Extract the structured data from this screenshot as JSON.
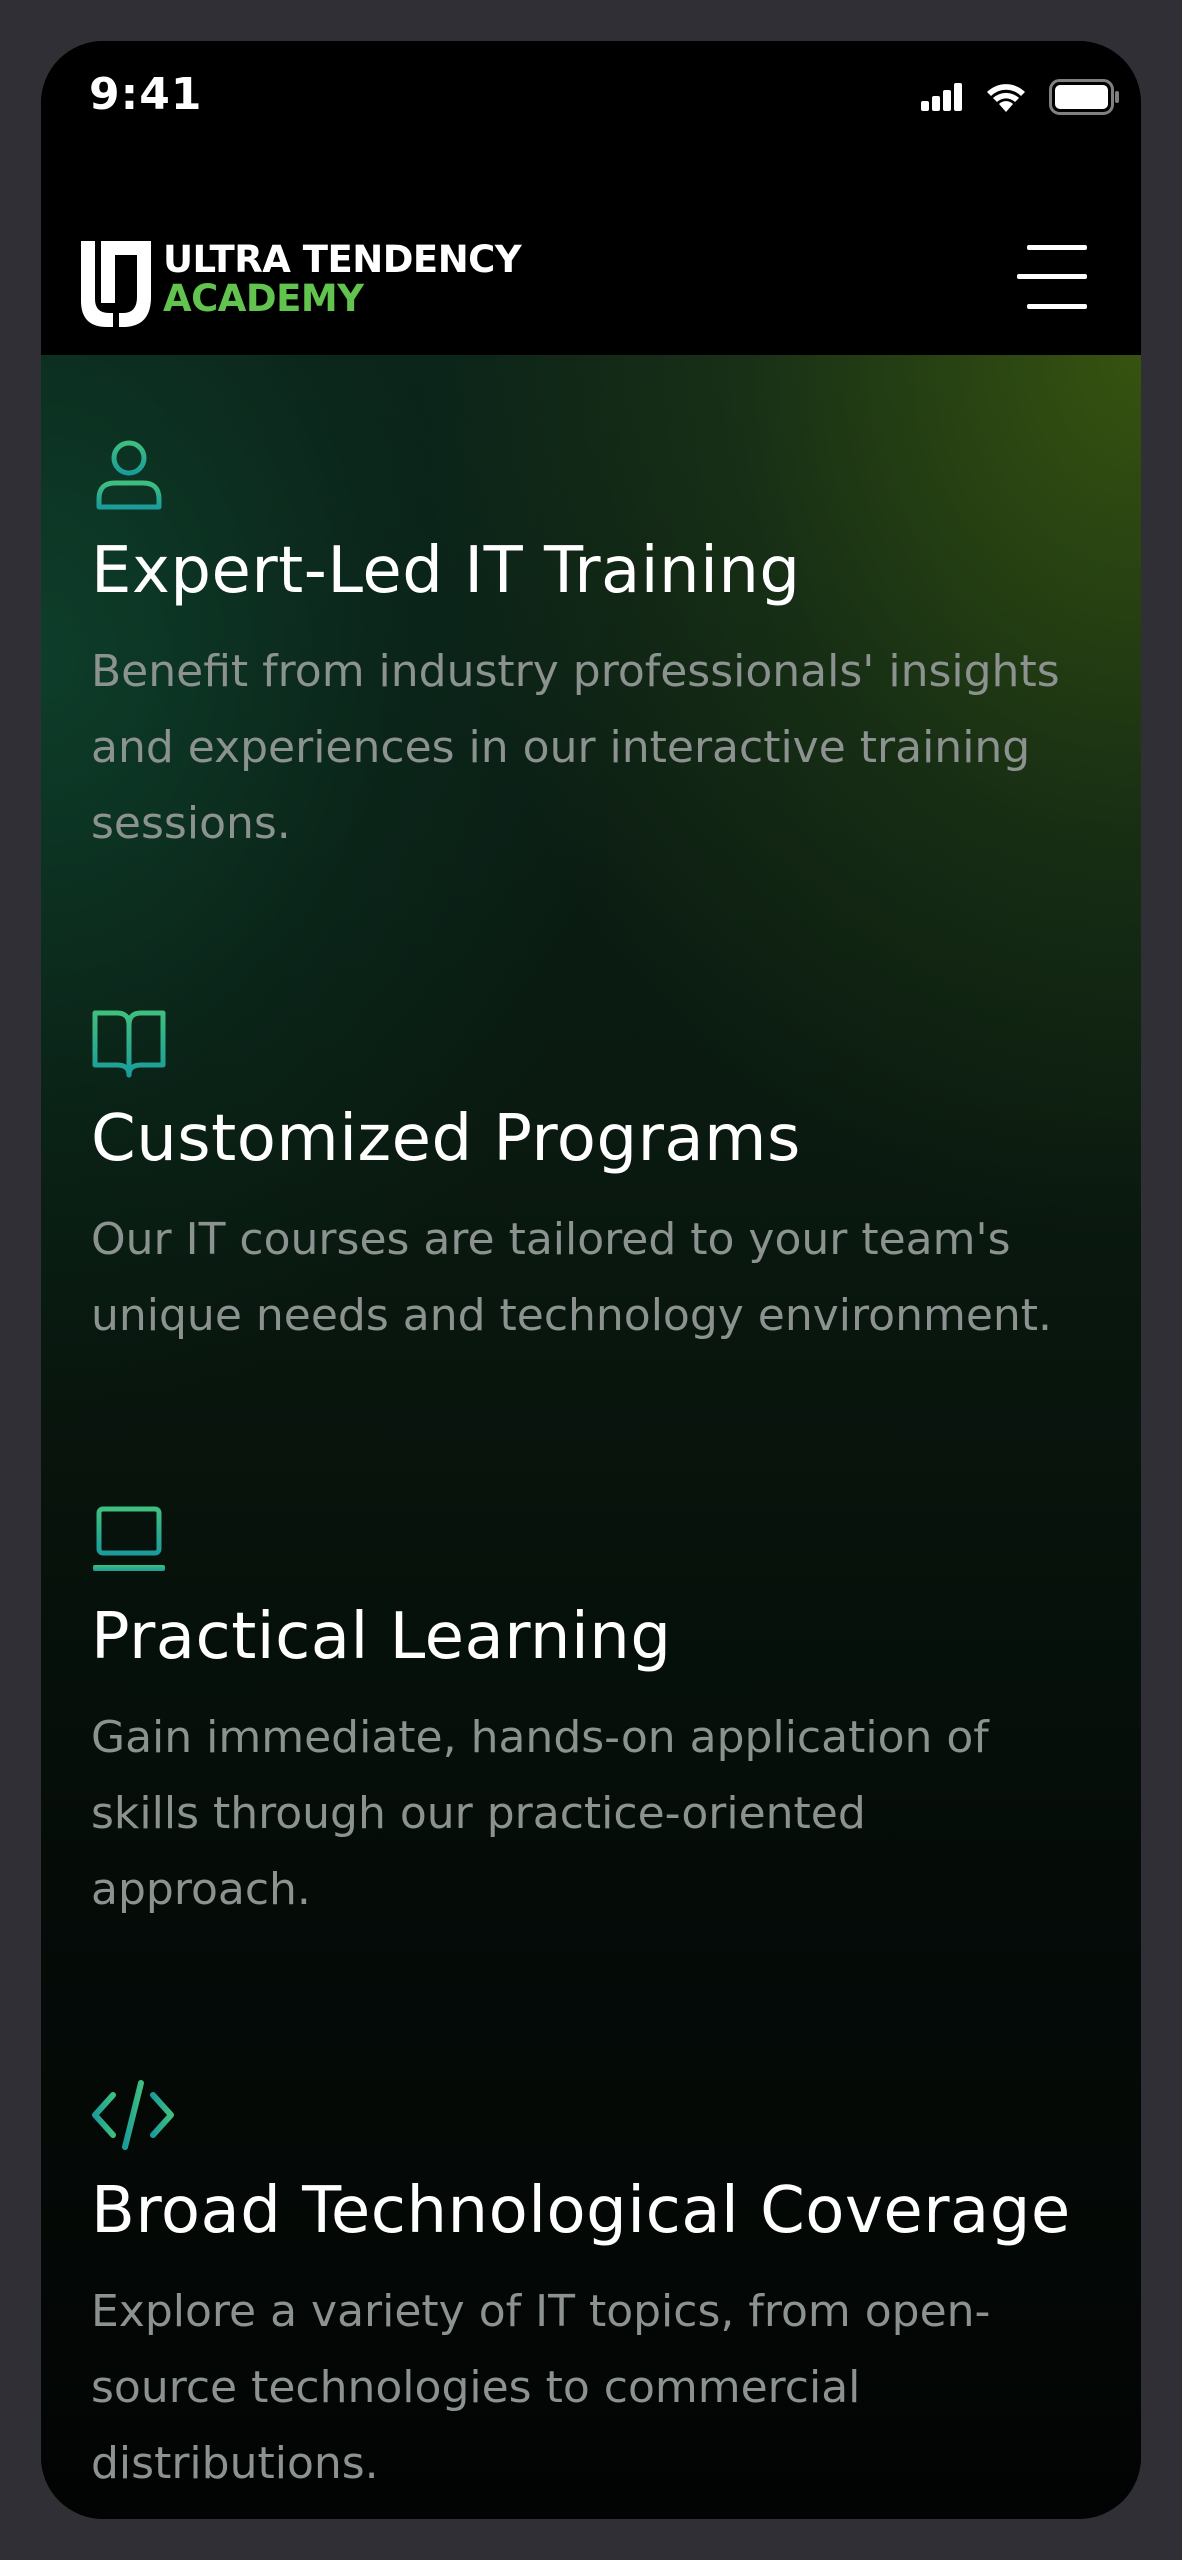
{
  "status_bar": {
    "time": "9:41",
    "icons": [
      "cellular-signal-icon",
      "wifi-icon",
      "battery-icon"
    ]
  },
  "header": {
    "logo": {
      "line1": "ULTRA TENDENCY",
      "line2": "ACADEMY",
      "mark_icon": "ultra-tendency-logo-icon"
    },
    "menu_icon": "hamburger-menu-icon"
  },
  "colors": {
    "brand_green": "#62c44f",
    "icon_teal": "#1fa98c",
    "text_primary": "#ffffff",
    "text_secondary": "#8b928f"
  },
  "features": [
    {
      "icon": "user-icon",
      "title": "Expert-Led IT Training",
      "description_lines": [
        "Benefit from industry professionals' insights",
        "and experiences in our interactive training",
        "sessions."
      ]
    },
    {
      "icon": "book-icon",
      "title": "Customized Programs",
      "description_lines": [
        "Our IT courses are tailored to your team's",
        "unique needs and technology environment."
      ]
    },
    {
      "icon": "laptop-icon",
      "title": "Practical Learning",
      "description_lines": [
        "Gain immediate, hands-on application of",
        "skills through our practice-oriented",
        "approach."
      ]
    },
    {
      "icon": "code-icon",
      "title": "Broad Technological Coverage",
      "description_lines": [
        "Explore a variety of IT topics, from open-",
        "source technologies to commercial",
        "distributions."
      ]
    }
  ]
}
